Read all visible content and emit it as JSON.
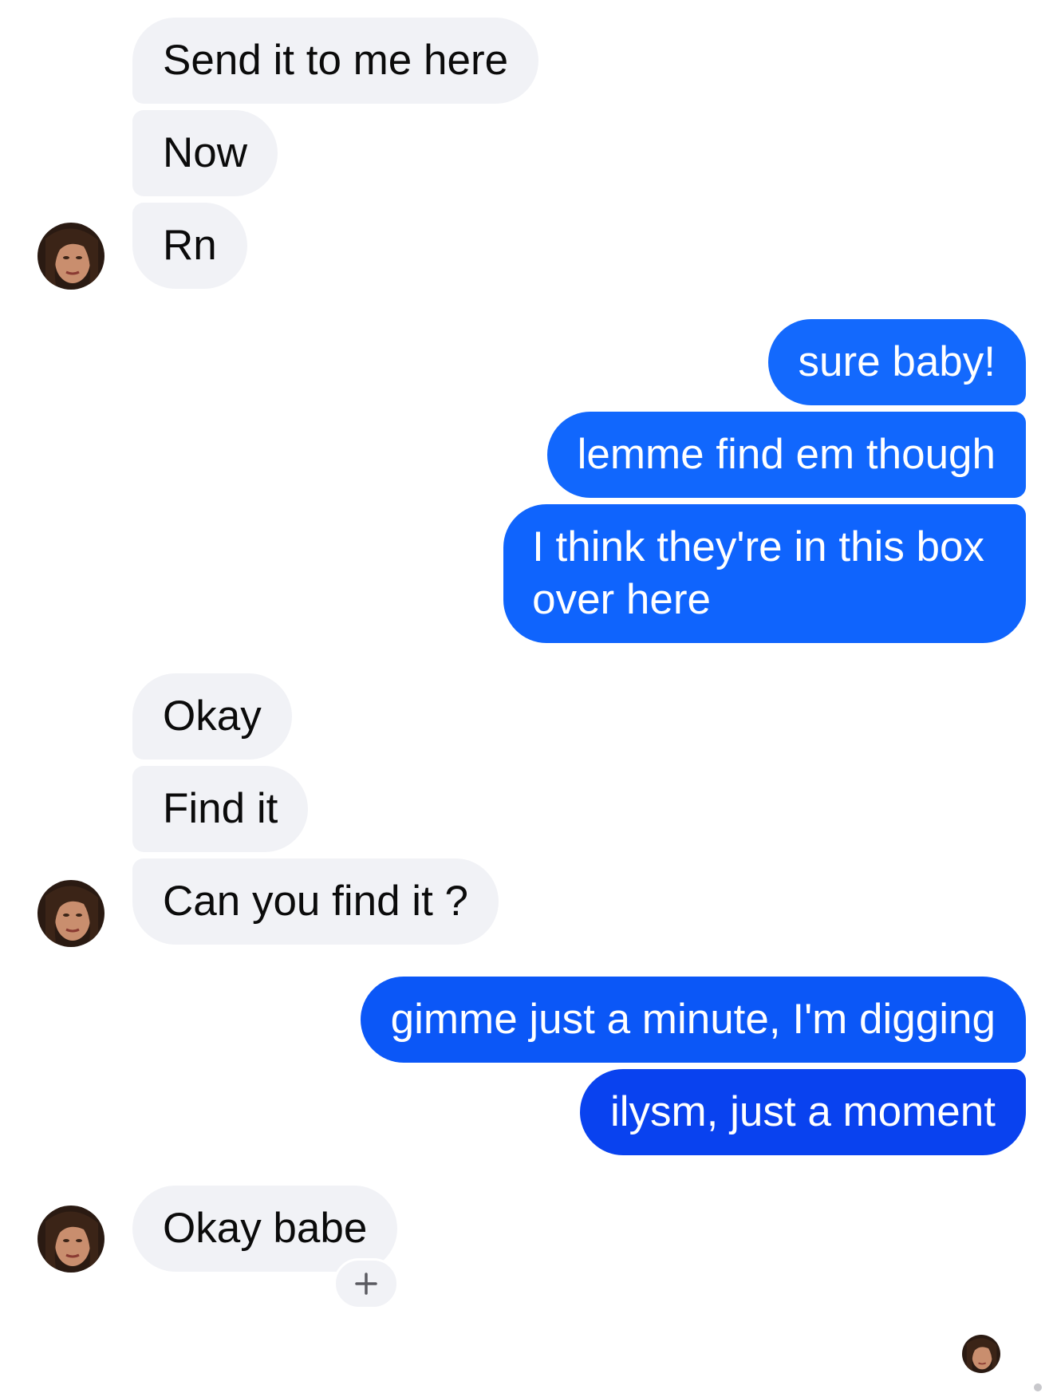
{
  "thread": {
    "messages": [
      {
        "from": "contact",
        "text": "Send it to me here"
      },
      {
        "from": "contact",
        "text": "Now"
      },
      {
        "from": "contact",
        "text": "Rn"
      },
      {
        "from": "me",
        "text": "sure baby!"
      },
      {
        "from": "me",
        "text": "lemme find em though"
      },
      {
        "from": "me",
        "text_line1": "I think they're in this box",
        "text_line2": "over here"
      },
      {
        "from": "contact",
        "text": "Okay"
      },
      {
        "from": "contact",
        "text": "Find it"
      },
      {
        "from": "contact",
        "text": "Can you find it ?"
      },
      {
        "from": "me",
        "text": "gimme just a minute, I'm digging"
      },
      {
        "from": "me",
        "text": "ilysm, just a moment"
      },
      {
        "from": "contact",
        "text": "Okay babe"
      }
    ]
  },
  "reaction": {
    "icon": "plus-icon",
    "glyph": "+"
  },
  "colors": {
    "incoming_bubble": "#f1f2f6",
    "outgoing_top": "#1a6cff",
    "outgoing_bottom": "#0b3ff0",
    "incoming_text": "#0b0b0b",
    "outgoing_text": "#ffffff"
  }
}
